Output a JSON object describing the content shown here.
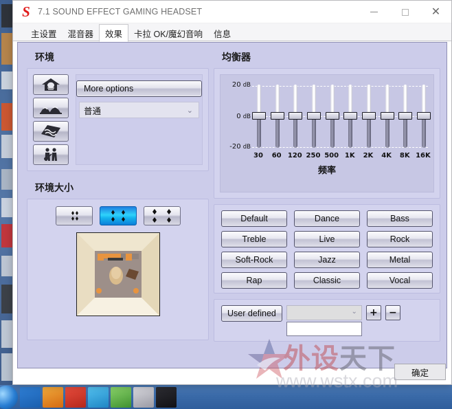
{
  "window": {
    "title": "7.1 SOUND EFFECT GAMING HEADSET",
    "logo_letter": "S",
    "logo_color": "#e01b1b",
    "controls": {
      "minimize": "minimize-icon",
      "maximize": "maximize-icon",
      "close": "close-icon"
    }
  },
  "tabs": [
    {
      "label": "主设置",
      "active": false
    },
    {
      "label": "混音器",
      "active": false
    },
    {
      "label": "效果",
      "active": true
    },
    {
      "label": "卡拉 OK/魔幻音响",
      "active": false
    },
    {
      "label": "信息",
      "active": false
    }
  ],
  "environment": {
    "title": "环境",
    "icons": [
      {
        "name": "room-environment-icon"
      },
      {
        "name": "cave-environment-icon"
      },
      {
        "name": "carpet-environment-icon"
      },
      {
        "name": "live-environment-icon"
      }
    ],
    "more_options_label": "More options",
    "select_value": "普通",
    "caret": "⌄"
  },
  "environment_size": {
    "title": "环境大小",
    "options": [
      {
        "name": "size-small",
        "selected": false
      },
      {
        "name": "size-medium",
        "selected": true
      },
      {
        "name": "size-large",
        "selected": false
      }
    ],
    "preview_name": "room-preview-image"
  },
  "equalizer": {
    "title": "均衡器",
    "xlabel": "频率",
    "axis_labels": [
      {
        "value": "20",
        "unit": "dB"
      },
      {
        "value": "0",
        "unit": "dB"
      },
      {
        "value": "-20",
        "unit": "dB"
      }
    ]
  },
  "chart_data": {
    "type": "bar",
    "title": "均衡器",
    "xlabel": "频率",
    "ylabel": "dB",
    "categories": [
      "30",
      "60",
      "120",
      "250",
      "500",
      "1K",
      "2K",
      "4K",
      "8K",
      "16K"
    ],
    "values": [
      0,
      0,
      0,
      0,
      0,
      0,
      0,
      0,
      0,
      0
    ],
    "ylim": [
      -20,
      20
    ],
    "yticks": [
      20,
      0,
      -20
    ],
    "ytick_labels": [
      "20 dB",
      "0 dB",
      "-20 dB"
    ],
    "grid": true,
    "legend": "none"
  },
  "presets": [
    "Default",
    "Dance",
    "Bass",
    "Treble",
    "Live",
    "Rock",
    "Soft-Rock",
    "Jazz",
    "Metal",
    "Rap",
    "Classic",
    "Vocal"
  ],
  "user_defined": {
    "button_label": "User defined",
    "select_value": "",
    "caret": "⌄",
    "input_value": "",
    "add_label": "+",
    "remove_label": "−"
  },
  "footer": {
    "ok_label": "确定"
  },
  "watermark": {
    "text_part1": "外设",
    "text_part2": "天下",
    "text_part1_color": "#c0565f",
    "text_part2_color": "#6a6a78",
    "url": "www.wstx.com"
  },
  "colors": {
    "panel": "#ccccea",
    "group": "#d3d3ee",
    "eq_inner": "#c7c7e4",
    "accent_selected": "#16b6ef"
  }
}
